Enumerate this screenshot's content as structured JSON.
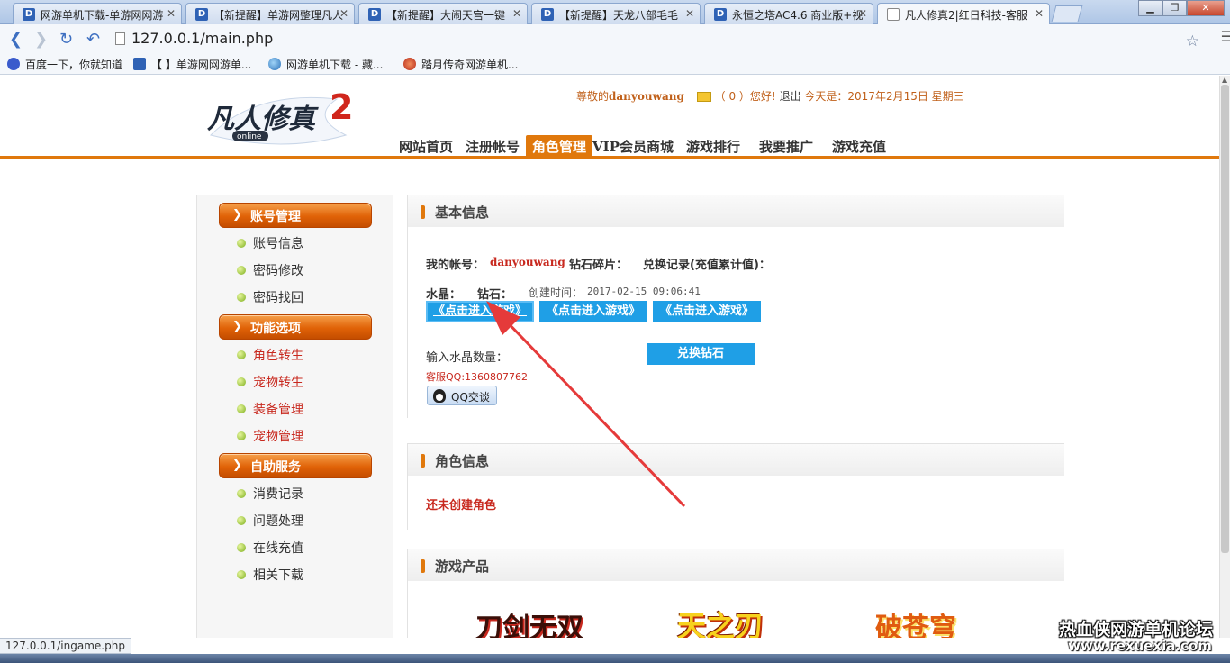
{
  "browser": {
    "tabs": [
      {
        "title": "网游单机下载-单游网网游",
        "icon": "d"
      },
      {
        "title": "【新提醒】单游网整理凡人",
        "icon": "d"
      },
      {
        "title": "【新提醒】大闹天宫一键",
        "icon": "d"
      },
      {
        "title": "【新提醒】天龙八部毛毛",
        "icon": "d"
      },
      {
        "title": "永恒之塔AC4.6 商业版+视",
        "icon": "d"
      },
      {
        "title": "凡人修真2|红日科技-客服",
        "icon": "page"
      }
    ],
    "url": "127.0.0.1/main.php",
    "bookmarks": [
      "百度一下，你就知道",
      "【 】单游网网游单...",
      "网游单机下载 - 藏...",
      "踏月传奇网游单机..."
    ],
    "status_url": "127.0.0.1/ingame.php"
  },
  "header": {
    "logo_text": "凡人修真",
    "logo_num": "2",
    "logo_sub": "online",
    "greeting_prefix": "尊敬的",
    "username": "danyouwang",
    "mail_count": "（ 0 ）您好!",
    "logout": "退出",
    "today": "今天是：2017年2月15日 星期三",
    "nav": [
      "网站首页",
      "注册帐号",
      "角色管理",
      "VIP会员商城",
      "游戏排行",
      "我要推广",
      "游戏充值"
    ]
  },
  "sidebar": {
    "sections": [
      {
        "title": "账号管理",
        "items": [
          "账号信息",
          "密码修改",
          "密码找回"
        ]
      },
      {
        "title": "功能选项",
        "items": [
          "角色转生",
          "宠物转生",
          "装备管理",
          "宠物管理"
        ]
      },
      {
        "title": "自助服务",
        "items": [
          "消费记录",
          "问题处理",
          "在线充值",
          "相关下载"
        ]
      }
    ]
  },
  "basic": {
    "title": "基本信息",
    "account_label": "我的帐号：",
    "account_value": "danyouwang",
    "diamond_frag_label": "钻石碎片：",
    "exchange_label": "兑换记录(充值累计值)：",
    "crystal_label": "水晶：",
    "diamond_label": "钻石：",
    "created_label": "创建时间：",
    "created_value": "2017-02-15 09:06:41",
    "enter_buttons": [
      "《点击进入游戏》",
      "《点击进入游戏》",
      "《点击进入游戏》"
    ],
    "input_label": "输入水晶数量：",
    "exchange_button": "兑换钻石",
    "service_qq": "客服QQ:1360807762",
    "qq_button": "QQ交谈"
  },
  "role": {
    "title": "角色信息",
    "empty": "还未创建角色"
  },
  "products": {
    "title": "游戏产品",
    "games": [
      "刀剑无双",
      "天之刃",
      "破苍穹"
    ]
  },
  "watermark": {
    "line1": "热血侠网游单机论坛",
    "line2": "www.rexuexia.com"
  },
  "colors": {
    "accent": "#e0780c",
    "button_blue": "#1f9fe6",
    "alert_red": "#c8291f"
  }
}
